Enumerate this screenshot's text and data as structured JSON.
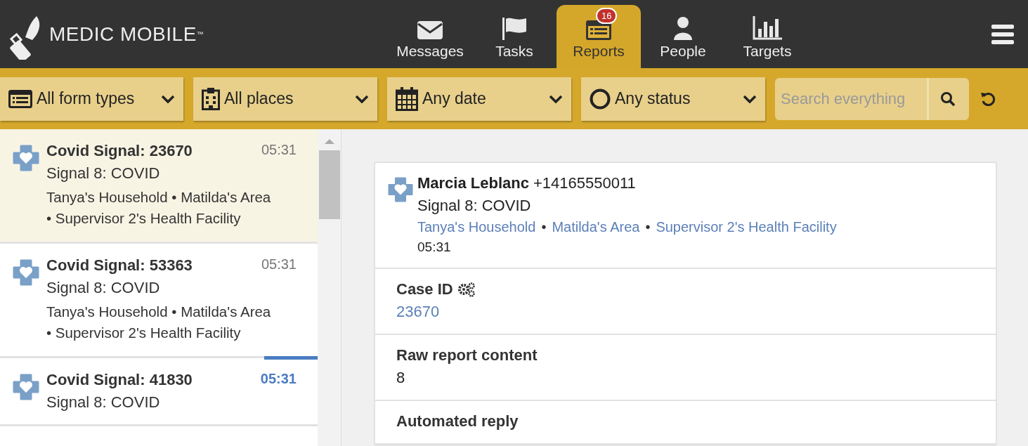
{
  "brand": {
    "name": "MEDIC MOBILE",
    "mark": "™"
  },
  "nav_tabs": [
    {
      "kind": "messages",
      "label": "Messages",
      "selected": false
    },
    {
      "kind": "tasks",
      "label": "Tasks",
      "selected": false
    },
    {
      "kind": "reports",
      "label": "Reports",
      "selected": true,
      "badge": "16"
    },
    {
      "kind": "people",
      "label": "People",
      "selected": false
    },
    {
      "kind": "targets",
      "label": "Targets",
      "selected": false
    }
  ],
  "filters": [
    {
      "kind": "form",
      "label": "All form types"
    },
    {
      "kind": "place",
      "label": "All places"
    },
    {
      "kind": "date",
      "label": "Any date"
    },
    {
      "kind": "status",
      "label": "Any status"
    }
  ],
  "search": {
    "placeholder": "Search everything"
  },
  "reports": [
    {
      "title": "Covid Signal: 23670",
      "time": "05:31",
      "form": "Signal 8: COVID",
      "places": "Tanya's Household • Matilda's Area • Supervisor 2's Health Facility",
      "selected": true,
      "unread": false
    },
    {
      "title": "Covid Signal: 53363",
      "time": "05:31",
      "form": "Signal 8: COVID",
      "places": "Tanya's Household • Matilda's Area • Supervisor 2's Health Facility",
      "selected": false,
      "unread": false
    },
    {
      "title": "Covid Signal: 41830",
      "time": "05:31",
      "form": "Signal 8: COVID",
      "selected": false,
      "unread": true
    }
  ],
  "detail": {
    "separator": "•",
    "name": "Marcia Leblanc",
    "phone": "+14165550011",
    "form": "Signal 8: COVID",
    "places": [
      "Tanya's Household",
      "Matilda's Area",
      "Supervisor 2's Health Facility"
    ],
    "time": "05:31",
    "fields": [
      {
        "label": "Case ID",
        "value": "23670",
        "kind": "case_id"
      },
      {
        "label": "Raw report content",
        "value": "8",
        "kind": "text"
      },
      {
        "label": "Automated reply",
        "kind": "text"
      }
    ]
  }
}
